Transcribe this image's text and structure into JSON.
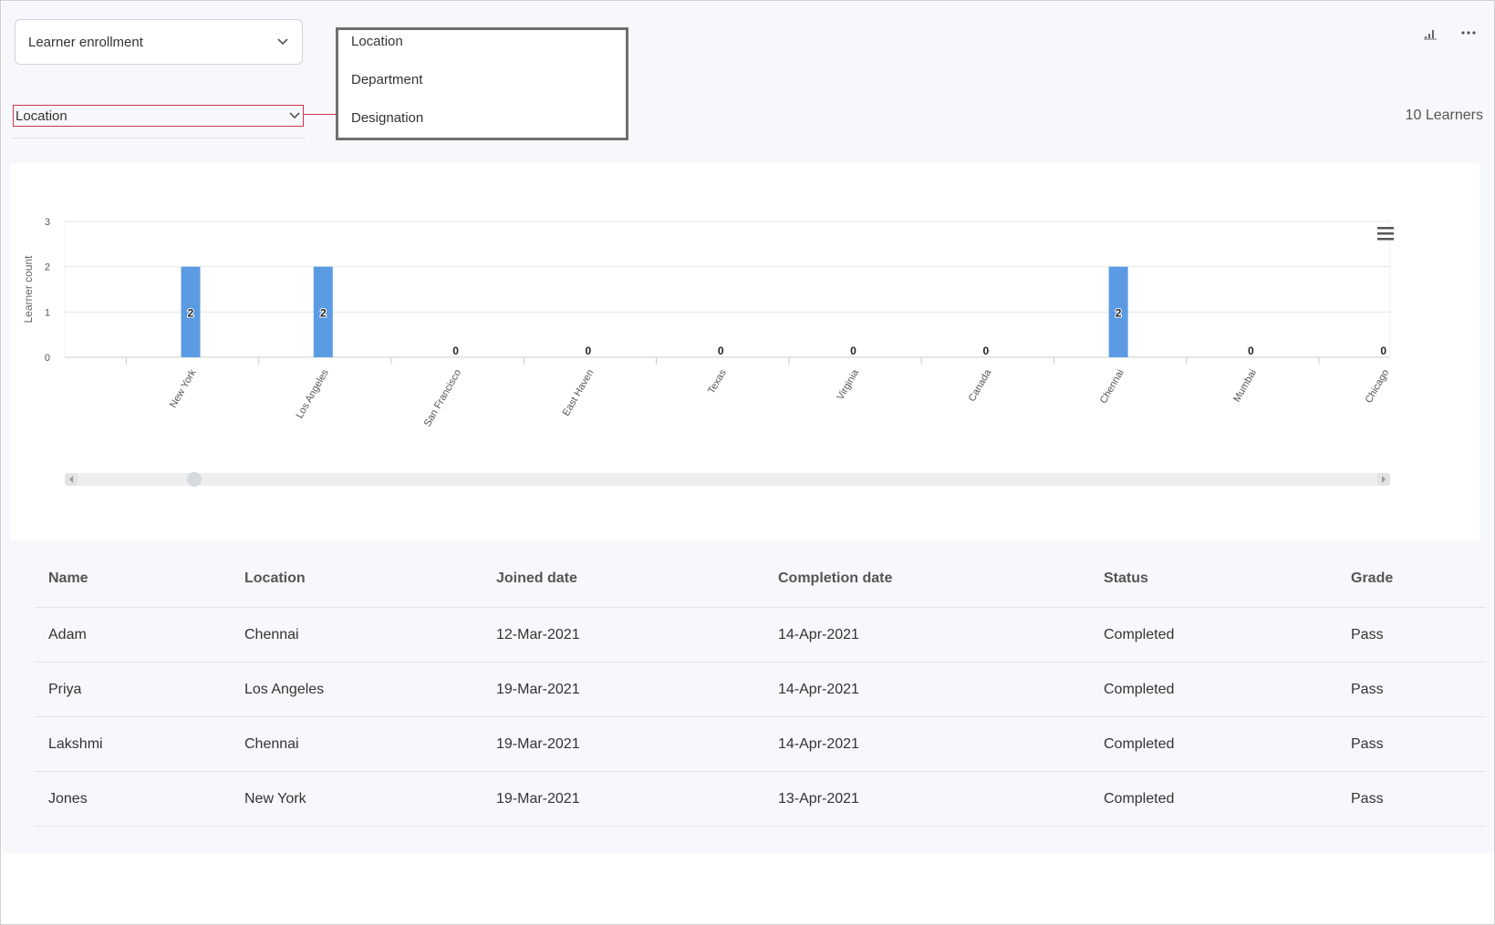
{
  "report_select": {
    "value": "Learner enrollment"
  },
  "group_by_select": {
    "value": "Location"
  },
  "dropdown": {
    "options": [
      "Location",
      "Department",
      "Designation"
    ]
  },
  "summary": {
    "learner_count": "10 Learners"
  },
  "icons": {
    "chart_toggle": "bar-chart-icon",
    "more": "more-horizontal-icon",
    "chart_menu": "hamburger-menu-icon"
  },
  "colors": {
    "bar": "#5a9be3",
    "accent_red": "#d0374b"
  },
  "chart_data": {
    "type": "bar",
    "categories": [
      "New York",
      "Los Angeles",
      "San Francisco",
      "East Haven",
      "Texas",
      "Virginia",
      "Canada",
      "Chennai",
      "Mumbai",
      "Chicago"
    ],
    "values": [
      2,
      2,
      0,
      0,
      0,
      0,
      0,
      2,
      0,
      0
    ],
    "ylabel": "Learner count",
    "ylim": [
      0,
      3
    ],
    "yticks": [
      "0",
      "1",
      "2",
      "3"
    ],
    "grid": true
  },
  "table": {
    "columns": [
      "Name",
      "Location",
      "Joined date",
      "Completion date",
      "Status",
      "Grade"
    ],
    "rows": [
      [
        "Adam",
        "Chennai",
        "12-Mar-2021",
        "14-Apr-2021",
        "Completed",
        "Pass"
      ],
      [
        "Priya",
        "Los Angeles",
        "19-Mar-2021",
        "14-Apr-2021",
        "Completed",
        "Pass"
      ],
      [
        "Lakshmi",
        "Chennai",
        "19-Mar-2021",
        "14-Apr-2021",
        "Completed",
        "Pass"
      ],
      [
        "Jones",
        "New York",
        "19-Mar-2021",
        "13-Apr-2021",
        "Completed",
        "Pass"
      ]
    ]
  }
}
